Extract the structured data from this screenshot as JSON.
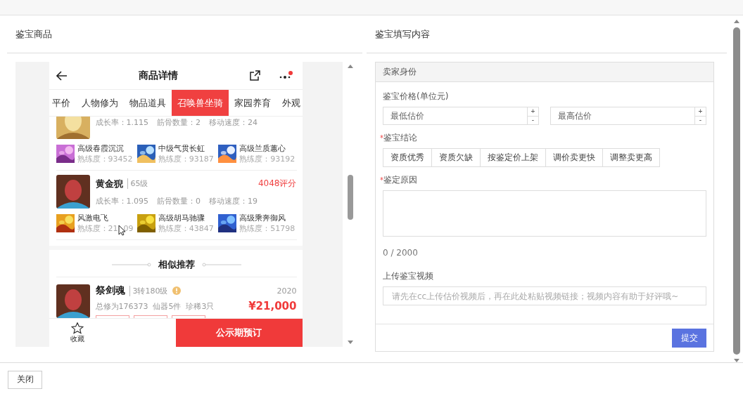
{
  "left_panel": {
    "title": "鉴宝商品",
    "phone": {
      "title": "商品详情",
      "has_notification": true,
      "tabs": [
        {
          "label": "平价",
          "selected": false
        },
        {
          "label": "人物修为",
          "selected": false
        },
        {
          "label": "物品道具",
          "selected": false
        },
        {
          "label": "召唤兽坐骑",
          "selected": true
        },
        {
          "label": "家园养育",
          "selected": false
        },
        {
          "label": "外观",
          "selected": false
        }
      ],
      "pets": [
        {
          "stats": [
            "成长率：1.115",
            "筋骨数量：2",
            "移动速度：24"
          ],
          "skills": [
            {
              "name": "高级春霞沉沉",
              "proficiency": [
                "熟练度：93452"
              ]
            },
            {
              "name": "中级气贯长虹",
              "proficiency": [
                "熟练度：93187"
              ]
            },
            {
              "name": "高级兰质蕙心",
              "proficiency": [
                "熟练度：93192"
              ]
            }
          ]
        },
        {
          "name": "黄金猊",
          "level": "65级",
          "score": "4048评分",
          "stats": [
            "成长率：1.095",
            "筋骨数量：0",
            "移动速度：19"
          ],
          "skills": [
            {
              "name": "风激电飞",
              "proficiency": [
                "熟练度：21",
                "09"
              ],
              "cursor": true
            },
            {
              "name": "高级胡马驰骤",
              "proficiency": [
                "熟练度：43847"
              ]
            },
            {
              "name": "高级乘奔御风",
              "proficiency": [
                "熟练度：51798"
              ]
            }
          ]
        }
      ],
      "similar": {
        "title": "相似推荐",
        "items": [
          {
            "name": "祭剑魂",
            "level": "3转180级",
            "year": "2020",
            "summary": "总修为176373  仙器5件  珍稀3只",
            "price": "¥21,000"
          }
        ]
      },
      "favorite": "收藏",
      "order_button": "公示期预订"
    }
  },
  "right_panel": {
    "title": "鉴宝填写内容",
    "section": "卖家身份",
    "price": {
      "label": "鉴宝价格(单位元)",
      "min_placeholder": "最低估价",
      "max_placeholder": "最高估价",
      "plus": "+",
      "minus": "-"
    },
    "conclusion": {
      "label": "鉴宝结论",
      "required_mark": "*",
      "options": [
        {
          "label": "资质优秀",
          "selected": false
        },
        {
          "label": "资质欠缺",
          "selected": false
        },
        {
          "label": "按鉴定价上架",
          "selected": false
        },
        {
          "label": "调价卖更快",
          "selected": false
        },
        {
          "label": "调整卖更高",
          "selected": false
        }
      ]
    },
    "reason": {
      "label": "鉴定原因",
      "required_mark": "*",
      "counter": "0 / 2000"
    },
    "video": {
      "label": "上传鉴宝视频",
      "placeholder": "请先在cc上传估价视频后，再在此处粘贴视频链接；视频内容有助于好评哦~"
    },
    "submit": "提交"
  },
  "footer": {
    "close": "关闭"
  }
}
